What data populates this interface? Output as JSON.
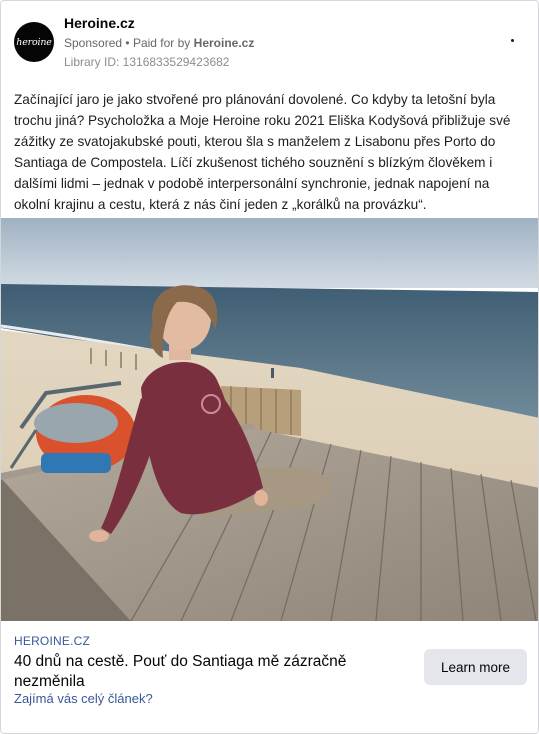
{
  "header": {
    "avatar_text": "heroine",
    "page_name": "Heroine.cz",
    "sponsored": "Sponsored",
    "separator": "•",
    "paid_for_prefix": "Paid for by",
    "paid_for_name": "Heroine.cz",
    "library_id": "Library ID: 1316833529423682"
  },
  "post": {
    "text": "Začínající jaro je jako stvořené pro plánování dovolené. Co kdyby ta letošní byla trochu jiná? Psycholožka a Moje Heroine roku 2021 Eliška Kodyšová přibližuje své zážitky ze svatojakubské pouti, kterou šla s manželem z Lisabonu přes Porto do Santiaga de Compostela. Líčí zkušenost tichého souznění s blízkým člověkem i dalšími lidmi – jednak v podobě interpersonální synchronie, jednak napojení na okolní krajinu a cestu, která z nás činí jeden z „korálků na provázku“."
  },
  "link": {
    "domain": "HEROINE.CZ",
    "headline": "40 dnů na cestě. Pouť do Santiaga mě zázračně nezměnila",
    "subline": "Zajímá vás celý článek?",
    "cta_label": "Learn more"
  },
  "colors": {
    "link_blue": "#385898",
    "muted_gray": "#65676b",
    "button_gray": "#e4e6eb"
  },
  "icons": {
    "more": "more-horizontal-icon"
  }
}
